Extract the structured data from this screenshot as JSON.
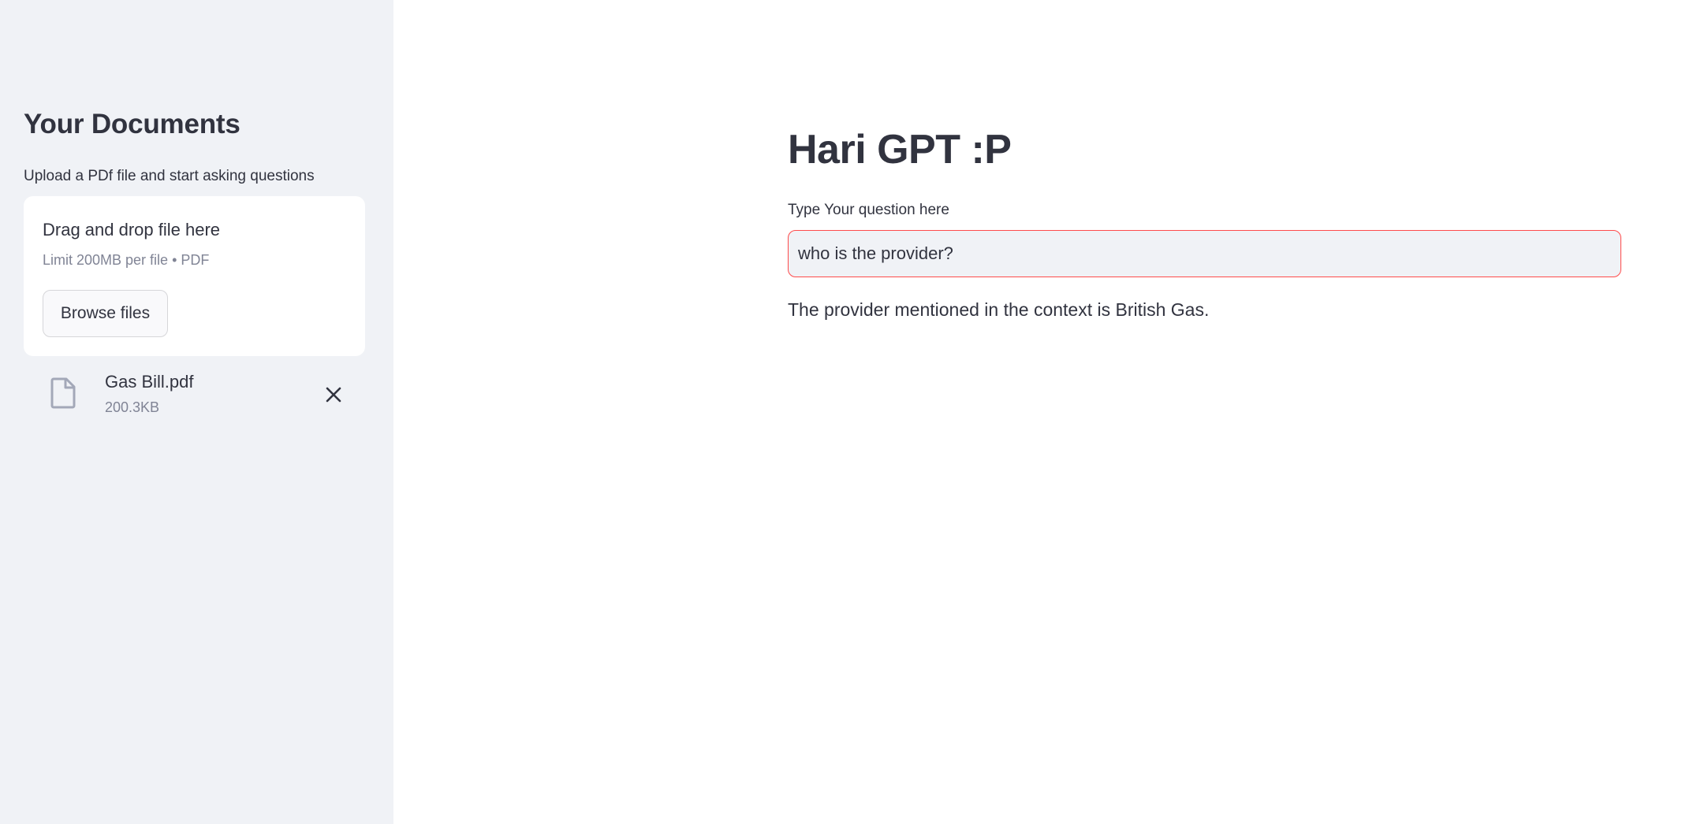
{
  "sidebar": {
    "title": "Your Documents",
    "subtitle": "Upload a PDf file and start asking questions",
    "uploader": {
      "dropzone_title": "Drag and drop file here",
      "limit_text": "Limit 200MB per file • PDF",
      "browse_label": "Browse files"
    },
    "file": {
      "name": "Gas Bill.pdf",
      "size": "200.3KB",
      "icon": "file-icon",
      "remove_icon": "close-icon"
    }
  },
  "main": {
    "title": "Hari GPT :P",
    "question_label": "Type Your question here",
    "question_value": "who is the provider?",
    "answer": "The provider mentioned in the context is British Gas."
  },
  "colors": {
    "sidebar_bg": "#f0f2f6",
    "text": "#31333f",
    "muted_text": "#808495",
    "input_focus_border": "#ff4b4b"
  }
}
